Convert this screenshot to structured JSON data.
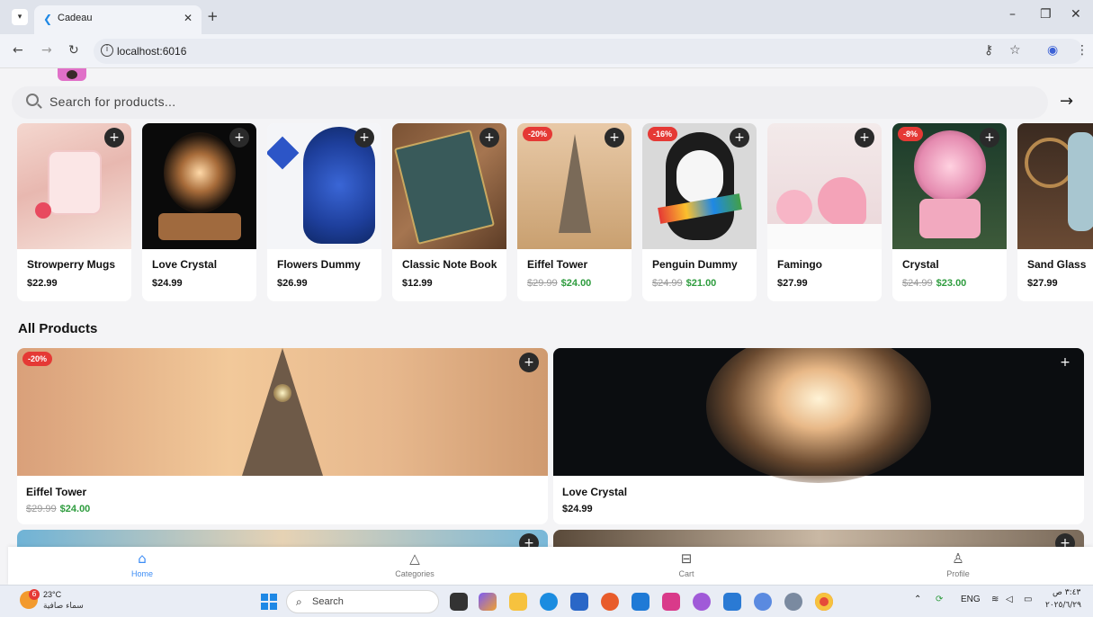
{
  "browser": {
    "tab_title": "Cadeau",
    "new_tab": "+",
    "url": "localhost:6016",
    "window_min": "–",
    "window_restore": "❐",
    "window_close": "✕"
  },
  "search": {
    "placeholder": "Search for products...",
    "submit_icon": "arrow-right-icon"
  },
  "featured": [
    {
      "name": "Strowperry Mugs",
      "price": "$22.99",
      "old_price": "",
      "badge": ""
    },
    {
      "name": "Love Crystal",
      "price": "$24.99",
      "old_price": "",
      "badge": ""
    },
    {
      "name": "Flowers Dummy",
      "price": "$26.99",
      "old_price": "",
      "badge": ""
    },
    {
      "name": "Classic Note Book",
      "price": "$12.99",
      "old_price": "",
      "badge": ""
    },
    {
      "name": "Eiffel Tower",
      "price": "$24.00",
      "old_price": "$29.99",
      "badge": "-20%"
    },
    {
      "name": "Penguin Dummy",
      "price": "$21.00",
      "old_price": "$24.99",
      "badge": "-16%"
    },
    {
      "name": "Famingo",
      "price": "$27.99",
      "old_price": "",
      "badge": ""
    },
    {
      "name": "Crystal",
      "price": "$23.00",
      "old_price": "$24.99",
      "badge": "-8%"
    },
    {
      "name": "Sand Glass",
      "price": "$27.99",
      "old_price": "",
      "badge": ""
    }
  ],
  "all_products": {
    "title": "All Products",
    "items": [
      {
        "name": "Eiffel Tower",
        "price": "$24.00",
        "old_price": "$29.99",
        "badge": "-20%"
      },
      {
        "name": "Love Crystal",
        "price": "$24.99",
        "old_price": "",
        "badge": ""
      }
    ]
  },
  "bottom_nav": [
    {
      "label": "Home",
      "active": true
    },
    {
      "label": "Categories",
      "active": false
    },
    {
      "label": "Cart",
      "active": false
    },
    {
      "label": "Profile",
      "active": false
    }
  ],
  "taskbar": {
    "weather_temp": "23°C",
    "weather_desc": "سماء صافية",
    "weather_badge": "6",
    "search_label": "Search",
    "lang": "ENG",
    "time": "٣:٤٣ ص",
    "date": "٢٠٢٥/٦/٢٩"
  },
  "colors": {
    "accent": "#3d8df5",
    "sale": "#2e9c3e",
    "badge": "#e53935"
  }
}
